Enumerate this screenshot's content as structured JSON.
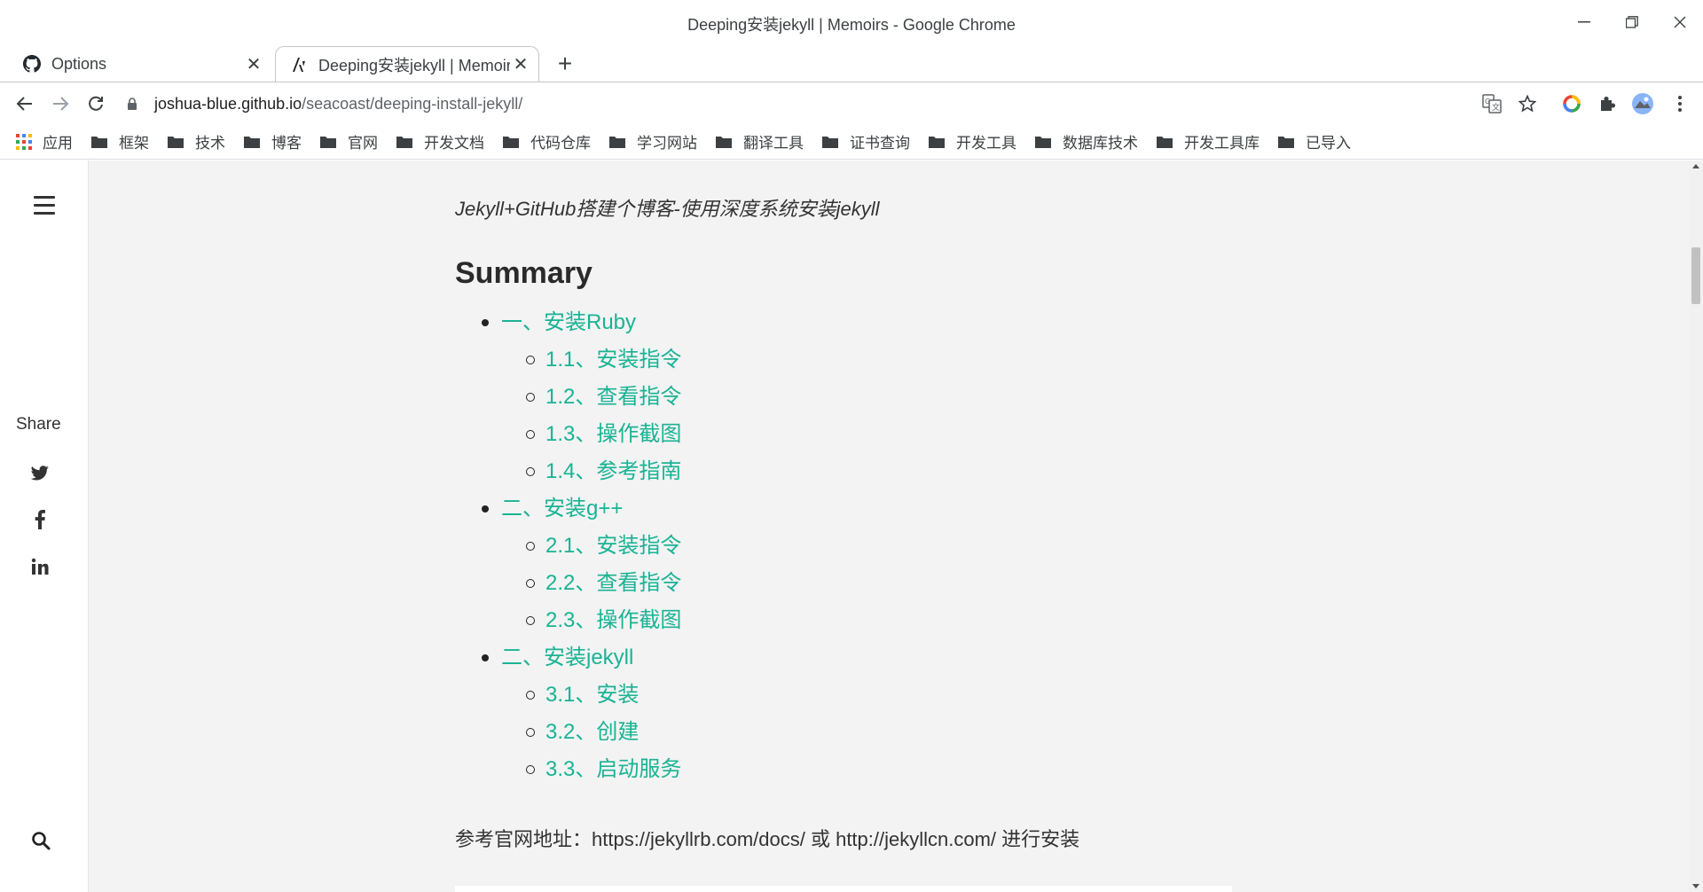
{
  "window": {
    "title": "Deeping安装jekyll | Memoirs - Google Chrome",
    "minimize": "—",
    "restore": "❐",
    "close": "✕"
  },
  "tabs": [
    {
      "label": "Options",
      "icon": "github-icon",
      "close": "✕"
    },
    {
      "label": "Deeping安装jekyll | Memoirs",
      "icon": "site-logo-icon",
      "close": "✕",
      "active": true
    }
  ],
  "newtab": "+",
  "address": {
    "host": "joshua-blue.github.io",
    "path": "/seacoast/deeping-install-jekyll/"
  },
  "bookmarks": [
    {
      "label": "应用",
      "icon": "apps-grid-icon"
    },
    {
      "label": "框架",
      "icon": "folder-icon"
    },
    {
      "label": "技术",
      "icon": "folder-icon"
    },
    {
      "label": "博客",
      "icon": "folder-icon"
    },
    {
      "label": "官网",
      "icon": "folder-icon"
    },
    {
      "label": "开发文档",
      "icon": "folder-icon"
    },
    {
      "label": "代码仓库",
      "icon": "folder-icon"
    },
    {
      "label": "学习网站",
      "icon": "folder-icon"
    },
    {
      "label": "翻译工具",
      "icon": "folder-icon"
    },
    {
      "label": "证书查询",
      "icon": "folder-icon"
    },
    {
      "label": "开发工具",
      "icon": "folder-icon"
    },
    {
      "label": "数据库技术",
      "icon": "folder-icon"
    },
    {
      "label": "开发工具库",
      "icon": "folder-icon"
    },
    {
      "label": "已导入",
      "icon": "folder-icon"
    }
  ],
  "sidebar": {
    "share_label": "Share",
    "social": [
      {
        "name": "twitter",
        "glyph": ""
      },
      {
        "name": "facebook",
        "glyph": "f"
      },
      {
        "name": "linkedin",
        "glyph": "in"
      }
    ]
  },
  "article": {
    "subtitle": "Jekyll+GitHub搭建个博客-使用深度系统安装jekyll",
    "summary_heading": "Summary",
    "toc": [
      {
        "level": 1,
        "text": "一、安装Ruby"
      },
      {
        "level": 2,
        "text": "1.1、安装指令"
      },
      {
        "level": 2,
        "text": "1.2、查看指令"
      },
      {
        "level": 2,
        "text": "1.3、操作截图"
      },
      {
        "level": 2,
        "text": "1.4、参考指南"
      },
      {
        "level": 1,
        "text": "二、安装g++"
      },
      {
        "level": 2,
        "text": "2.1、安装指令"
      },
      {
        "level": 2,
        "text": "2.2、查看指令"
      },
      {
        "level": 2,
        "text": "2.3、操作截图"
      },
      {
        "level": 1,
        "text": "二、安装jekyll"
      },
      {
        "level": 2,
        "text": "3.1、安装"
      },
      {
        "level": 2,
        "text": "3.2、创建"
      },
      {
        "level": 2,
        "text": "3.3、启动服务"
      }
    ],
    "reference": "参考官网地址：https://jekyllrb.com/docs/ 或 http://jekyllcn.com/ 进行安装"
  },
  "colors": {
    "link": "#1ab394",
    "page_bg": "#f3f3f3"
  }
}
